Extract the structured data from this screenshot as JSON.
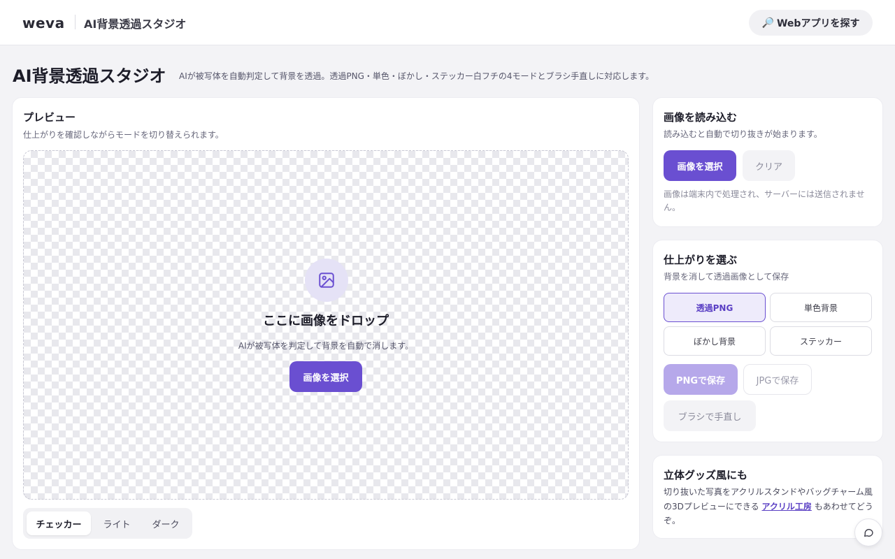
{
  "header": {
    "logo": "weva",
    "app_title": "AI背景透過スタジオ",
    "find_apps_label": "Webアプリを探す",
    "find_apps_icon": "🔎"
  },
  "page": {
    "title": "AI背景透過スタジオ",
    "description": "AIが被写体を自動判定して背景を透過。透過PNG・単色・ぼかし・ステッカー白フチの4モードとブラシ手直しに対応します。"
  },
  "preview": {
    "title": "プレビュー",
    "subtitle": "仕上がりを確認しながらモードを切り替えられます。",
    "drop_title": "ここに画像をドロップ",
    "drop_subtitle": "AIが被写体を判定して背景を自動で消します。",
    "select_button": "画像を選択",
    "bg_options": [
      "チェッカー",
      "ライト",
      "ダーク"
    ],
    "bg_selected": "チェッカー"
  },
  "load": {
    "title": "画像を読み込む",
    "subtitle": "読み込むと自動で切り抜きが始まります。",
    "select_button": "画像を選択",
    "clear_button": "クリア",
    "note": "画像は端末内で処理され、サーバーには送信されません。"
  },
  "finish": {
    "title": "仕上がりを選ぶ",
    "subtitle": "背景を消して透過画像として保存",
    "modes": [
      "透過PNG",
      "単色背景",
      "ぼかし背景",
      "ステッカー"
    ],
    "selected_mode": "透過PNG",
    "save_png": "PNGで保存",
    "save_jpg": "JPGで保存",
    "brush": "ブラシで手直し"
  },
  "goods": {
    "title": "立体グッズ風にも",
    "text_before": "切り抜いた写真をアクリルスタンドやバッグチャーム風の3Dプレビューにできる",
    "link": "アクリル工房",
    "text_after": "もあわせてどうぞ。"
  },
  "colors": {
    "accent": "#6a4fd1",
    "accent_disabled": "#b6a8ea",
    "background": "#f3f3f6"
  }
}
